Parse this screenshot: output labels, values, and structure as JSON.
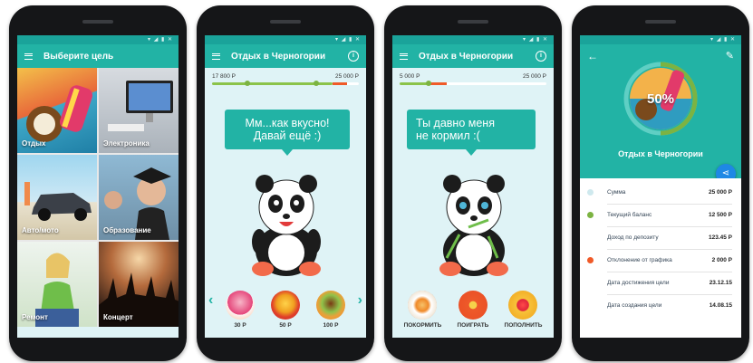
{
  "status_icons": "▾ ◢ ▮ ✕",
  "phone1": {
    "title": "Выберите цель",
    "tiles": [
      {
        "label": "Отдых"
      },
      {
        "label": "Электроника"
      },
      {
        "label": "Авто/мото"
      },
      {
        "label": "Образование"
      },
      {
        "label": "Ремонт"
      },
      {
        "label": "Концерт"
      }
    ]
  },
  "phone2": {
    "title": "Отдых в Черногории",
    "progress_current": "17 800 Р",
    "progress_target": "25 000 Р",
    "progress_fraction": 0.71,
    "bubble": "Мм...как вкусно!\nДавай ещё :)",
    "foods": [
      {
        "price": "30 Р",
        "icon": "ice-cream-icon"
      },
      {
        "price": "50 Р",
        "icon": "fries-icon"
      },
      {
        "price": "100 Р",
        "icon": "burger-icon"
      }
    ]
  },
  "phone3": {
    "title": "Отдых в Черногории",
    "progress_current": "5 000 Р",
    "progress_target": "25 000 Р",
    "progress_fraction": 0.2,
    "bubble": "Ты давно меня\nне кормил :(",
    "actions": [
      {
        "label": "ПОКОРМИТЬ",
        "icon": "food-plate-icon"
      },
      {
        "label": "ПОИГРАТЬ",
        "icon": "target-icon"
      },
      {
        "label": "ПОПОЛНИТЬ",
        "icon": "ruby-icon"
      }
    ]
  },
  "phone4": {
    "percent": "50%",
    "goal_name": "Отдых в Черногории",
    "rows": [
      {
        "label": "Сумма",
        "value": "25 000 Р",
        "dot": "#cfe9ee"
      },
      {
        "label": "Текущий баланс",
        "value": "12 500 Р",
        "dot": "#7cb342"
      },
      {
        "label": "Доход по депозиту",
        "value": "123.45 Р",
        "dot": ""
      },
      {
        "label": "Отклонение от графика",
        "value": "2 000 Р",
        "dot": "#f05a28"
      },
      {
        "label": "Дата достижения цели",
        "value": "23.12.15",
        "dot": ""
      },
      {
        "label": "Дата создания цели",
        "value": "14.08.15",
        "dot": ""
      }
    ]
  },
  "colors": {
    "teal": "#22b3a5",
    "green": "#7cb342",
    "orange": "#f05a28",
    "blue": "#1e88e5"
  }
}
